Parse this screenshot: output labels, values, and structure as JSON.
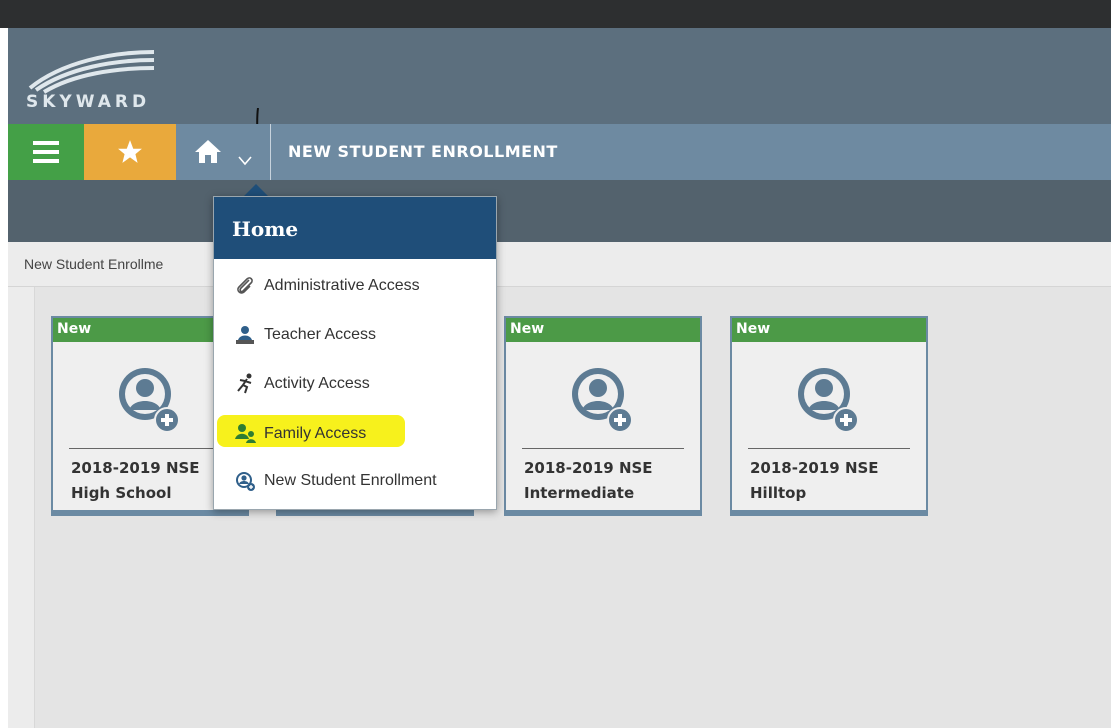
{
  "app": {
    "logo_text": "SKYWARD"
  },
  "nav": {
    "title": "NEW STUDENT ENROLLMENT"
  },
  "breadcrumb": "New Student Enrollme",
  "dropdown": {
    "header": "Home",
    "items": [
      {
        "label": "Administrative Access",
        "icon": "paperclip-icon"
      },
      {
        "label": "Teacher Access",
        "icon": "teacher-icon"
      },
      {
        "label": "Activity Access",
        "icon": "runner-icon"
      },
      {
        "label": "Family Access",
        "icon": "family-icon",
        "highlighted": true
      },
      {
        "label": "New Student Enrollment",
        "icon": "enrollment-icon"
      }
    ]
  },
  "tiles": [
    {
      "badge": "New",
      "line1": "2018-2019 NSE",
      "line2": "High School"
    },
    {
      "badge": "New",
      "line1": "2018-2019 NSE",
      "line2": "Intermediate"
    },
    {
      "badge": "New",
      "line1": "2018-2019 NSE",
      "line2": "Hilltop"
    }
  ],
  "colors": {
    "menu_green": "#44a047",
    "favorite_orange": "#e9a93c",
    "navbar_blue": "#6e8aa1",
    "dropdown_header": "#1f4e79",
    "badge_green": "#4c9a47",
    "highlight_yellow": "#f7f11c"
  }
}
